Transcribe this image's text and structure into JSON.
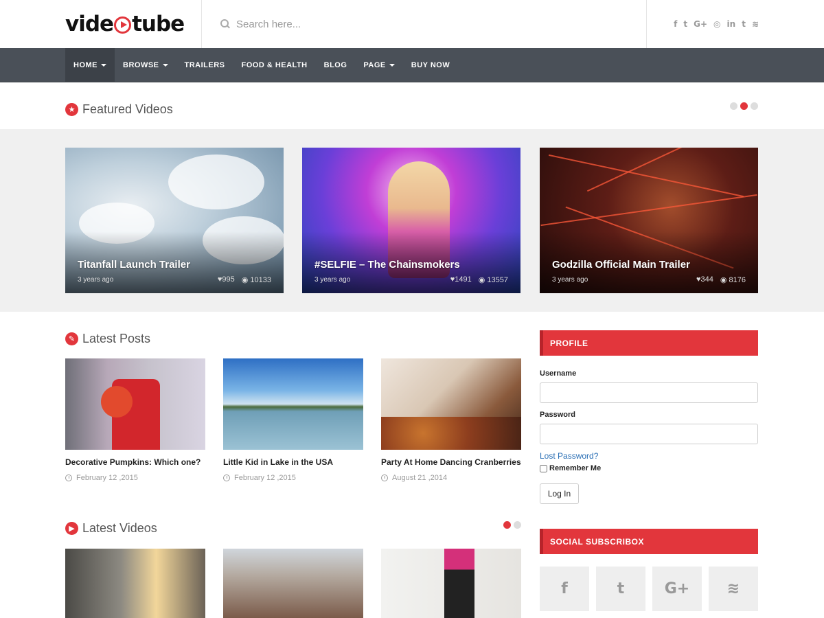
{
  "header": {
    "logo_left": "vide",
    "logo_right": "tube",
    "search_placeholder": "Search here...",
    "social": [
      "f",
      "t",
      "G+",
      "◎",
      "in",
      "t",
      "≋"
    ]
  },
  "nav": {
    "items": [
      {
        "label": "HOME",
        "dropdown": true
      },
      {
        "label": "BROWSE",
        "dropdown": true
      },
      {
        "label": "TRAILERS",
        "dropdown": false
      },
      {
        "label": "FOOD & HEALTH",
        "dropdown": false
      },
      {
        "label": "BLOG",
        "dropdown": false
      },
      {
        "label": "PAGE",
        "dropdown": true
      },
      {
        "label": "BUY NOW",
        "dropdown": false
      }
    ]
  },
  "featured": {
    "title": "Featured Videos",
    "videos": [
      {
        "title": "Titanfall Launch Trailer",
        "date": "3 years ago",
        "likes": "995",
        "views": "10133"
      },
      {
        "title": "#SELFIE – The Chainsmokers",
        "date": "3 years ago",
        "likes": "1491",
        "views": "13557"
      },
      {
        "title": "Godzilla Official Main Trailer",
        "date": "3 years ago",
        "likes": "344",
        "views": "8176"
      }
    ]
  },
  "latest_posts": {
    "title": "Latest Posts",
    "posts": [
      {
        "title": "Decorative Pumpkins: Which one?",
        "date": "February 12 ,2015"
      },
      {
        "title": "Little Kid in Lake in the USA",
        "date": "February 12 ,2015"
      },
      {
        "title": "Party At Home Dancing Cranberries",
        "date": "August 21 ,2014"
      }
    ]
  },
  "latest_videos": {
    "title": "Latest Videos"
  },
  "sidebar": {
    "profile": {
      "title": "PROFILE",
      "username_label": "Username",
      "password_label": "Password",
      "lost_password": "Lost Password?",
      "remember_me": "Remember Me",
      "login_button": "Log In"
    },
    "subscribe": {
      "title": "SOCIAL SUBSCRIBOX",
      "icons": [
        "f",
        "t",
        "G+",
        "≋"
      ]
    }
  },
  "colors": {
    "accent": "#e2363c",
    "nav_bg": "#4a5058"
  }
}
